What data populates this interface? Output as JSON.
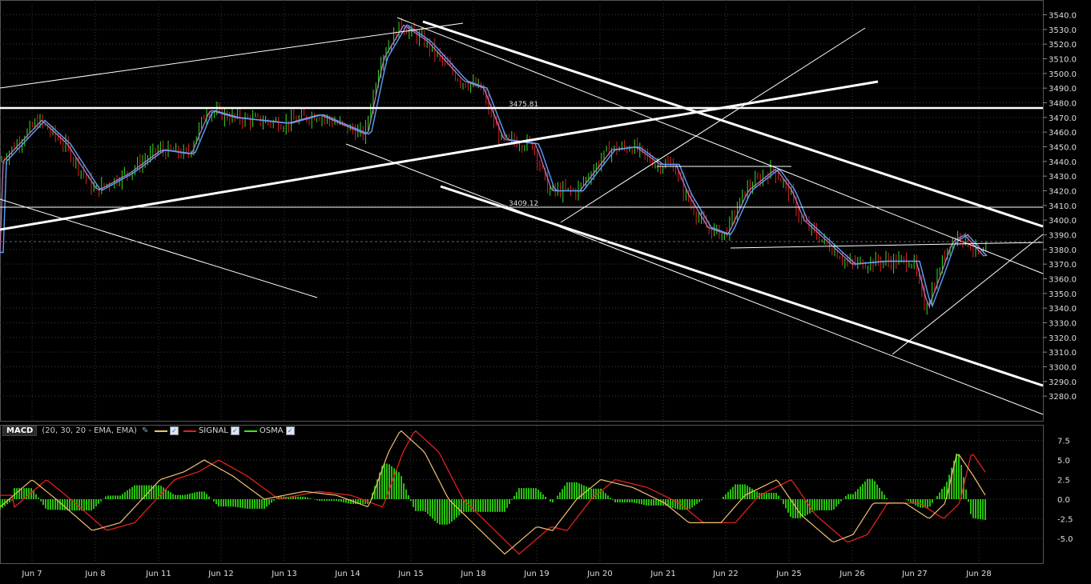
{
  "price_chart": {
    "y_axis": {
      "min": 3270,
      "max": 3545,
      "ticks": [
        3540,
        3530,
        3520,
        3510,
        3500,
        3490,
        3480,
        3470,
        3460,
        3450,
        3440,
        3430,
        3420,
        3410,
        3400,
        3390,
        3380,
        3370,
        3360,
        3350,
        3340,
        3330,
        3320,
        3310,
        3300,
        3290,
        3280
      ]
    },
    "x_labels": [
      "Jun 7",
      "Jun 8",
      "Jun 11",
      "Jun 12",
      "Jun 13",
      "Jun 14",
      "Jun 15",
      "Jun 18",
      "Jun 19",
      "Jun 20",
      "Jun 21",
      "Jun 22",
      "Jun 25",
      "Jun 26",
      "Jun 27",
      "Jun 28"
    ],
    "level_labels": [
      "3475.81",
      "3409.12"
    ]
  },
  "macd_panel": {
    "name": "MACD",
    "params": "(20, 30, 20 - EMA, EMA)",
    "legend": [
      {
        "label": "",
        "color": "#f0c070"
      },
      {
        "label": "SIGNAL",
        "color": "#e02020"
      },
      {
        "label": "OSMA",
        "color": "#33ee11"
      }
    ],
    "y_ticks": [
      "7.5",
      "5.0",
      "2.5",
      "0.0",
      "-2.5",
      "-5.0"
    ]
  },
  "chart_data": [
    {
      "type": "line",
      "title": "",
      "xlabel": "",
      "ylabel": "",
      "ylim": [
        3270,
        3545
      ],
      "categories": [
        "Jun 7",
        "Jun 8",
        "Jun 11",
        "Jun 12",
        "Jun 13",
        "Jun 14",
        "Jun 15",
        "Jun 18",
        "Jun 19",
        "Jun 20",
        "Jun 21",
        "Jun 22",
        "Jun 25",
        "Jun 26",
        "Jun 27",
        "Jun 28"
      ],
      "series": [
        {
          "values": [
            3465,
            3420,
            3450,
            3478,
            3468,
            3458,
            3535,
            3500,
            3415,
            3448,
            3430,
            3395,
            3430,
            3368,
            3335,
            3380
          ]
        }
      ],
      "horizontal_levels": [
        3475.81,
        3409.12
      ],
      "grid": true
    },
    {
      "type": "line",
      "title": "",
      "ylim": [
        -7.5,
        9
      ],
      "categories": [
        "Jun 7",
        "Jun 8",
        "Jun 11",
        "Jun 12",
        "Jun 13",
        "Jun 14",
        "Jun 15",
        "Jun 18",
        "Jun 19",
        "Jun 20",
        "Jun 21",
        "Jun 22",
        "Jun 25",
        "Jun 26",
        "Jun 27",
        "Jun 28"
      ],
      "series": [
        {
          "name": "SIGNAL",
          "values": [
            2.5,
            -4.0,
            0.5,
            4.0,
            0.5,
            0.0,
            8.5,
            2.0,
            -6.0,
            2.0,
            -0.5,
            -3.0,
            2.5,
            -5.5,
            -1.5,
            3.0
          ]
        },
        {
          "name": "OSMA",
          "values": [
            2.0,
            -1.5,
            1.5,
            1.5,
            -0.5,
            0.5,
            4.0,
            -2.5,
            -0.5,
            2.5,
            -0.5,
            -0.5,
            2.0,
            -1.0,
            1.0,
            3.5
          ]
        }
      ]
    }
  ],
  "colors": {
    "background": "#000000",
    "grid": "#3a3a3a",
    "bull": "#33dd22",
    "bear": "#dd2222",
    "ema_blue": "#5aa0ff",
    "ema_pink": "#c080c0",
    "trendline": "#ffffff",
    "macd_line": "#f0c070",
    "signal_line": "#e02020",
    "osma": "#33ee11"
  }
}
